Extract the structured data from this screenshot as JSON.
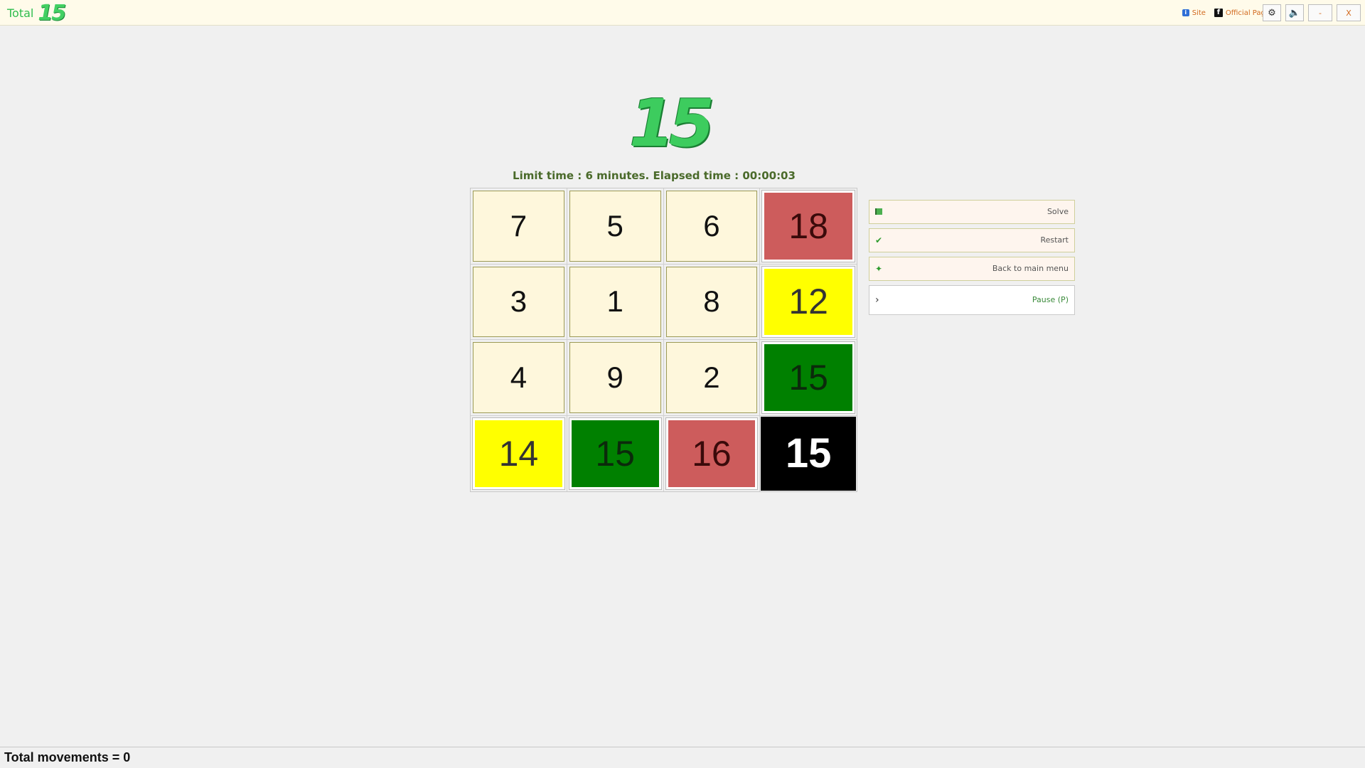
{
  "app": {
    "title_word": "Total",
    "title_number": "15"
  },
  "links": {
    "site": "Site",
    "official_page": "Official Page"
  },
  "window": {
    "minimize": "-",
    "close": "X"
  },
  "logo": "15",
  "timer": {
    "text": "Limit time : 6 minutes.  Elapsed time : 00:00:03"
  },
  "board": {
    "tiles": [
      {
        "value": "7",
        "color": "plain"
      },
      {
        "value": "5",
        "color": "plain"
      },
      {
        "value": "6",
        "color": "plain"
      },
      {
        "value": "18",
        "color": "red"
      },
      {
        "value": "3",
        "color": "plain"
      },
      {
        "value": "1",
        "color": "plain"
      },
      {
        "value": "8",
        "color": "plain"
      },
      {
        "value": "12",
        "color": "yellow"
      },
      {
        "value": "4",
        "color": "plain"
      },
      {
        "value": "9",
        "color": "plain"
      },
      {
        "value": "2",
        "color": "plain"
      },
      {
        "value": "15",
        "color": "green"
      },
      {
        "value": "14",
        "color": "yellow"
      },
      {
        "value": "15",
        "color": "green"
      },
      {
        "value": "16",
        "color": "red"
      },
      {
        "value": "15",
        "color": "black"
      }
    ],
    "colors": {
      "plain": "#fef7dc",
      "red": "#cd5c5c",
      "yellow": "#ffff00",
      "green": "#008000",
      "black": "#000000"
    }
  },
  "menu": {
    "solve": "Solve",
    "restart": "Restart",
    "back": "Back to main menu",
    "pause": "Pause (P)"
  },
  "status": {
    "text": "Total movements = 0"
  }
}
